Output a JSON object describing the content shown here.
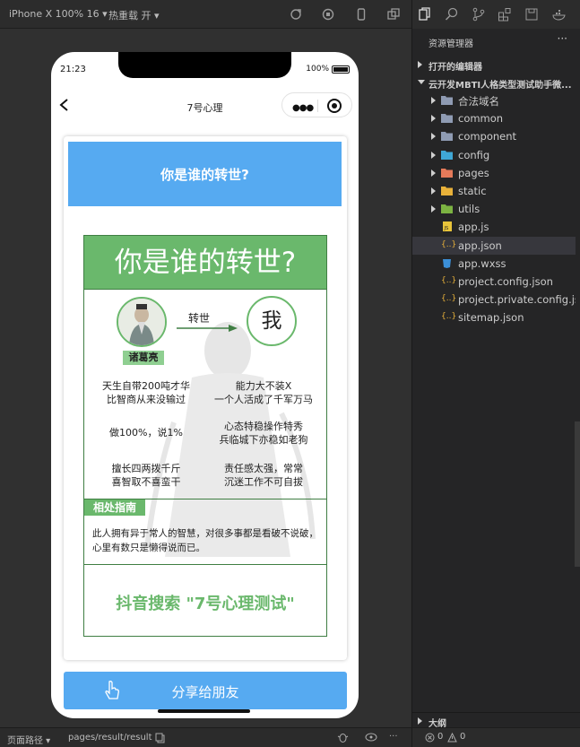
{
  "toolbar": {
    "device": "iPhone X 100% 16",
    "hot_reload": "热重载 开"
  },
  "phone": {
    "time": "21:23",
    "battery": "100%",
    "nav_title": "7号心理",
    "card_header": "你是谁的转世?",
    "poster": {
      "title": "你是谁的转世?",
      "person_name": "诸葛亮",
      "arrow_label": "转世",
      "me_label": "我",
      "traits": [
        {
          "line1": "天生自带200吨才华",
          "line2": "比智商从来没输过"
        },
        {
          "line1": "能力大不装X",
          "line2": "一个人活成了千军万马"
        },
        {
          "line1": "做100%，说1%",
          "line2": ""
        },
        {
          "line1": "心态特稳操作特秀",
          "line2": "兵临城下亦稳如老狗"
        },
        {
          "line1": "擅长四两拨千斤",
          "line2": "喜智取不喜蛮干"
        },
        {
          "line1": "责任感太强，常常",
          "line2": "沉迷工作不可自拔"
        }
      ],
      "guide_tag": "相处指南",
      "guide_text": "此人拥有异于常人的智慧，对很多事都是看破不说破，心里有数只是懒得说而已。",
      "search_text": "抖音搜索 \"7号心理测试\""
    },
    "share_button": "分享给朋友"
  },
  "statusbar": {
    "path_label": "页面路径",
    "path": "pages/result/result"
  },
  "explorer": {
    "title": "资源管理器",
    "open_editors": "打开的编辑器",
    "project": "云开发MBTI人格类型测试助手微...",
    "items": [
      {
        "label": "合法域名",
        "type": "folder",
        "color": "#8f9bb3"
      },
      {
        "label": "common",
        "type": "folder",
        "color": "#8f9bb3"
      },
      {
        "label": "component",
        "type": "folder",
        "color": "#8f9bb3"
      },
      {
        "label": "config",
        "type": "folder",
        "color": "#3fa7d6"
      },
      {
        "label": "pages",
        "type": "folder",
        "color": "#e57a5a"
      },
      {
        "label": "static",
        "type": "folder",
        "color": "#e8b13a"
      },
      {
        "label": "utils",
        "type": "folder",
        "color": "#7cb342"
      },
      {
        "label": "app.js",
        "type": "js",
        "color": "#e8c43a"
      },
      {
        "label": "app.json",
        "type": "json",
        "color": "#e8b13a",
        "selected": true
      },
      {
        "label": "app.wxss",
        "type": "wxss",
        "color": "#3b8fd8"
      },
      {
        "label": "project.config.json",
        "type": "json",
        "color": "#e8b13a"
      },
      {
        "label": "project.private.config.js...",
        "type": "json",
        "color": "#e8b13a"
      },
      {
        "label": "sitemap.json",
        "type": "json",
        "color": "#e8b13a"
      }
    ],
    "outline": "大纲",
    "errors": "0",
    "warnings": "0"
  }
}
